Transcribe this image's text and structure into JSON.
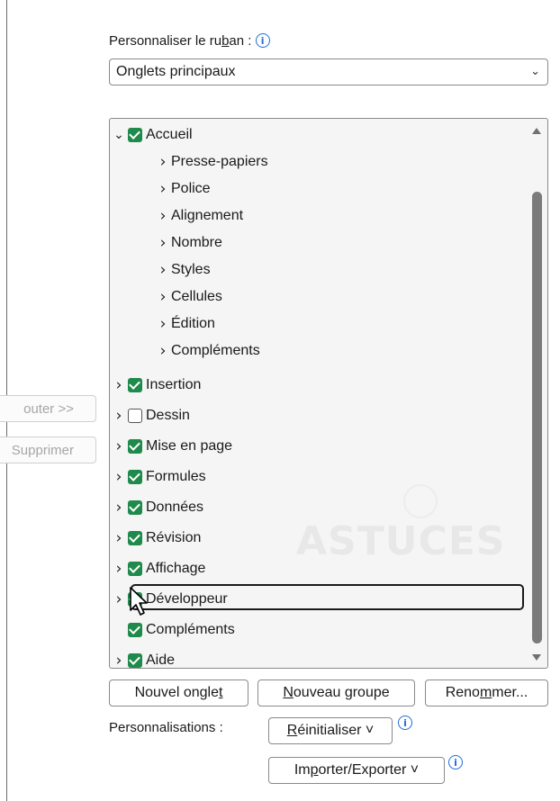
{
  "side_buttons": {
    "add_label": "outer >>",
    "remove_label": "Supprimer"
  },
  "ribbon": {
    "label_prefix": "Personnaliser le ru",
    "label_underline": "b",
    "label_suffix": "an :",
    "info_icon": "info-icon",
    "combo_value": "Onglets principaux",
    "combo_icon": "chevron-down-icon"
  },
  "tree": {
    "accueil": "Accueil",
    "groups": [
      "Presse-papiers",
      "Police",
      "Alignement",
      "Nombre",
      "Styles",
      "Cellules",
      "Édition",
      "Compléments"
    ],
    "tabs": [
      {
        "label": "Insertion",
        "checked": true
      },
      {
        "label": "Dessin",
        "checked": false
      },
      {
        "label": "Mise en page",
        "checked": true
      },
      {
        "label": "Formules",
        "checked": true
      },
      {
        "label": "Données",
        "checked": true
      },
      {
        "label": "Révision",
        "checked": true
      },
      {
        "label": "Affichage",
        "checked": true
      },
      {
        "label": "Développeur",
        "checked": true
      },
      {
        "label": "Compléments",
        "checked": true
      },
      {
        "label": "Aide",
        "checked": true
      }
    ],
    "watermark": "ASTUCES",
    "check_color": "#1f8a4c"
  },
  "buttons": {
    "new_tab_a": "Nouvel ongle",
    "new_tab_u": "t",
    "new_tab_b": "",
    "new_group_a": "",
    "new_group_u": "N",
    "new_group_b": "ouveau groupe",
    "rename_a": "Reno",
    "rename_u": "m",
    "rename_b": "mer..."
  },
  "customizations": {
    "label": "Personnalisations :",
    "reset_u": "R",
    "reset_b": "éinitialiser",
    "import_a": "Im",
    "import_u": "p",
    "import_b": "orter/Exporter",
    "dropdown_glyph": "˅"
  }
}
